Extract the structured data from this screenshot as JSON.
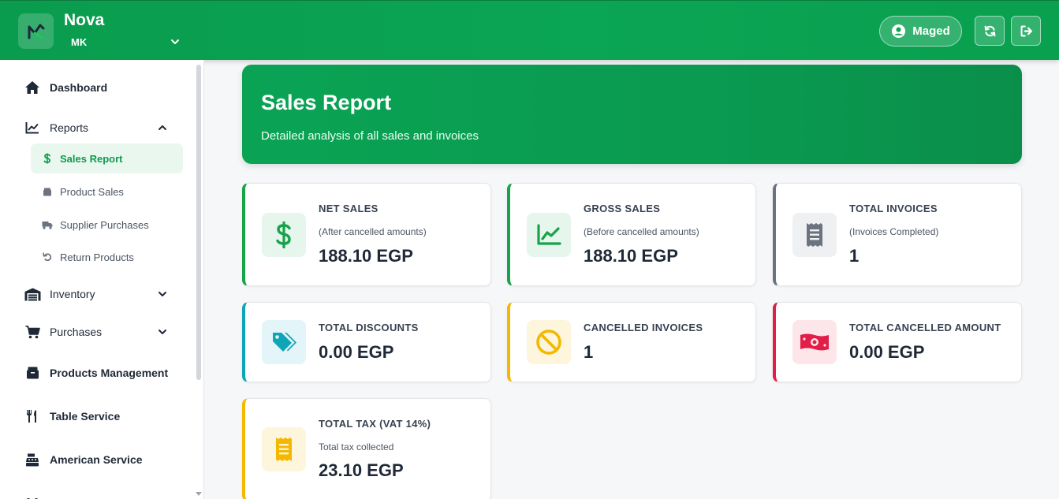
{
  "header": {
    "brand_name": "Nova",
    "brand_sub": "MK",
    "user_label": "Maged",
    "icons": [
      "brand-logo",
      "chevron-down-icon",
      "user-circle-icon",
      "refresh-icon",
      "logout-icon"
    ]
  },
  "sidebar": {
    "items": [
      {
        "label": "Dashboard",
        "icon": "home-icon"
      },
      {
        "label": "Reports",
        "icon": "chart-line-icon",
        "expanded": true
      },
      {
        "label": "Inventory",
        "icon": "warehouse-icon"
      },
      {
        "label": "Purchases",
        "icon": "cart-icon"
      },
      {
        "label": "Products Management",
        "icon": "box-icon"
      },
      {
        "label": "Table Service",
        "icon": "utensils-icon"
      },
      {
        "label": "American Service",
        "icon": "cash-register-icon"
      }
    ],
    "reports_sub": [
      {
        "label": "Sales Report",
        "icon": "dollar-icon",
        "active": true
      },
      {
        "label": "Product Sales",
        "icon": "box-icon"
      },
      {
        "label": "Supplier Purchases",
        "icon": "truck-icon"
      },
      {
        "label": "Return Products",
        "icon": "undo-icon"
      }
    ]
  },
  "banner": {
    "title": "Sales Report",
    "subtitle": "Detailed analysis of all sales and invoices"
  },
  "cards": [
    {
      "title": "NET SALES",
      "sub": "(After cancelled amounts)",
      "value": "188.10 EGP",
      "accent": "#16a34a",
      "icon": "dollar-icon"
    },
    {
      "title": "GROSS SALES",
      "sub": "(Before cancelled amounts)",
      "value": "188.10 EGP",
      "accent": "#16a34a",
      "icon": "chart-line-icon"
    },
    {
      "title": "TOTAL INVOICES",
      "sub": "(Invoices Completed)",
      "value": "1",
      "accent": "#6b7280",
      "icon": "receipt-icon"
    },
    {
      "title": "TOTAL DISCOUNTS",
      "value": "0.00 EGP",
      "accent": "#0ea5b7",
      "icon": "tags-icon"
    },
    {
      "title": "CANCELLED INVOICES",
      "value": "1",
      "accent": "#f5b800",
      "icon": "ban-icon"
    },
    {
      "title": "TOTAL CANCELLED AMOUNT",
      "value": "0.00 EGP",
      "accent": "#e11d48",
      "icon": "money-bill-icon"
    },
    {
      "title": "TOTAL TAX (VAT 14%)",
      "sub": "Total tax collected",
      "value": "23.10 EGP",
      "accent": "#f5b800",
      "icon": "file-invoice-icon"
    }
  ]
}
